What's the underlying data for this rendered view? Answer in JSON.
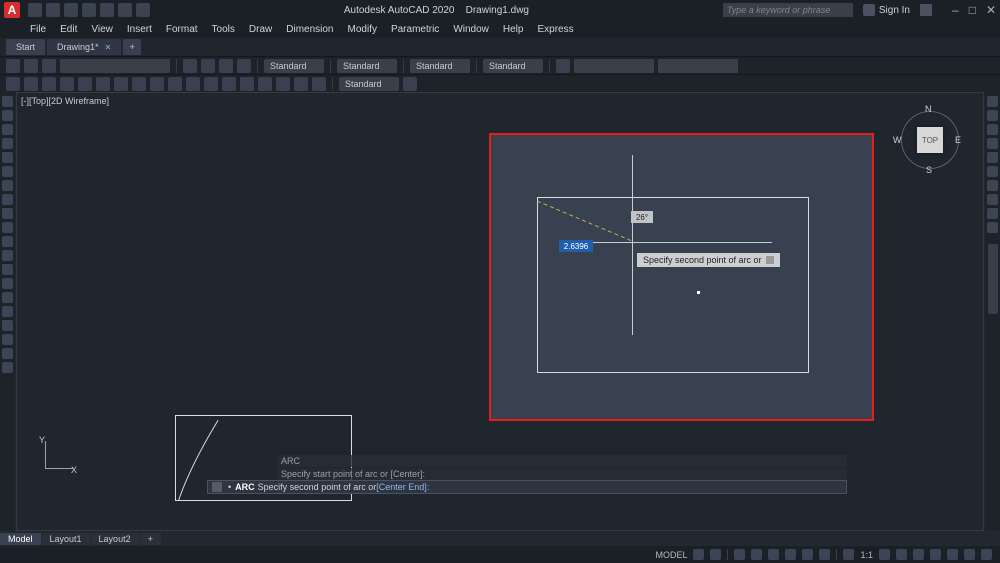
{
  "title": {
    "app": "Autodesk AutoCAD 2020",
    "doc": "Drawing1.dwg"
  },
  "logo": "A",
  "search": {
    "placeholder": "Type a keyword or phrase"
  },
  "signin": {
    "label": "Sign In"
  },
  "menu": {
    "file": "File",
    "edit": "Edit",
    "view": "View",
    "insert": "Insert",
    "format": "Format",
    "tools": "Tools",
    "draw": "Draw",
    "dimension": "Dimension",
    "modify": "Modify",
    "parametric": "Parametric",
    "window": "Window",
    "help": "Help",
    "express": "Express"
  },
  "tabs": {
    "start": "Start",
    "drawing": "Drawing1*"
  },
  "styles": {
    "s1": "Standard",
    "s2": "Standard",
    "s3": "Standard",
    "s4": "Standard",
    "s5": "Standard"
  },
  "view": {
    "label": "[-][Top][2D Wireframe]"
  },
  "viewcube": {
    "top": "TOP",
    "n": "N",
    "s": "S",
    "e": "E",
    "w": "W"
  },
  "dyn": {
    "angle": "26°",
    "value": "2.6396",
    "tooltip": "Specify second point of arc or"
  },
  "ucs": {
    "x": "X",
    "y": "Y"
  },
  "cmd": {
    "hist1": "ARC",
    "hist2": "Specify start point of arc or [Center]:",
    "prompt_cmd": "ARC",
    "prompt_txt": "Specify second point of arc or ",
    "prompt_opts": "[Center End]:"
  },
  "btabs": {
    "model": "Model",
    "l1": "Layout1",
    "l2": "Layout2",
    "plus": "+"
  },
  "status": {
    "model": "MODEL",
    "scale": "1:1"
  }
}
